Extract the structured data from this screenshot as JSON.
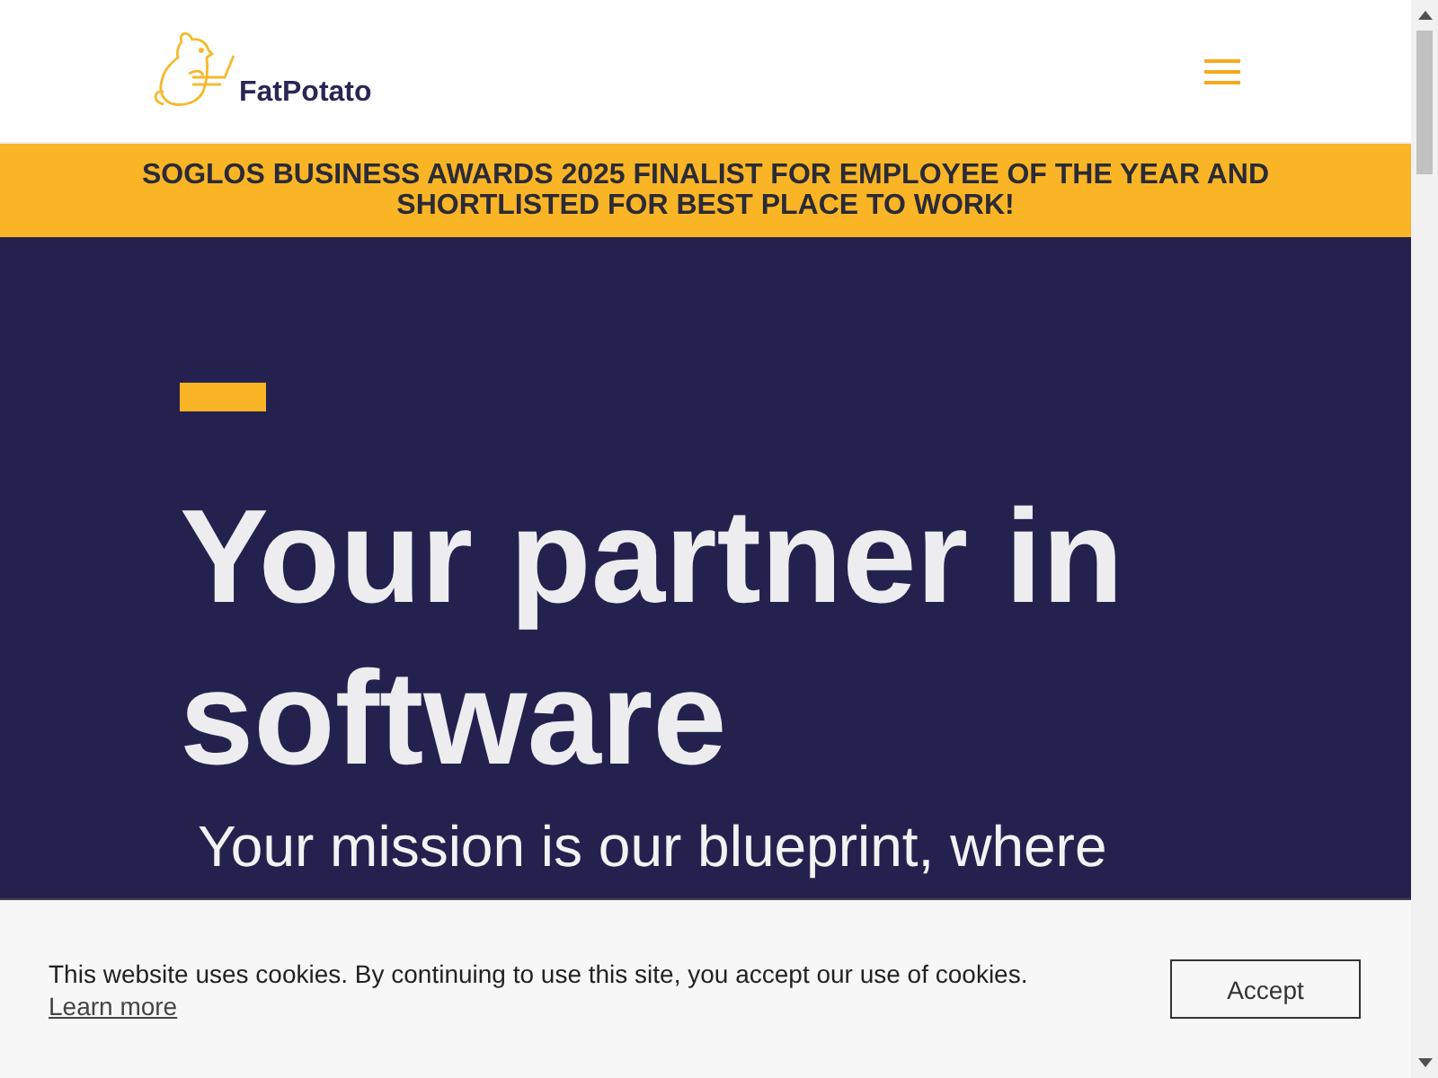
{
  "header": {
    "logo_text": "FatPotato"
  },
  "banner": {
    "text": "SOGLOS BUSINESS AWARDS 2025 FINALIST FOR EMPLOYEE OF THE YEAR AND SHORTLISTED FOR BEST PLACE TO WORK!"
  },
  "hero": {
    "heading": "Your partner in software",
    "paragraph": "Your mission is our blueprint, where"
  },
  "cookie_bar": {
    "message": "This website uses cookies. By continuing to use this site, you accept our use of cookies.",
    "link": "Learn more",
    "button": "Accept"
  }
}
